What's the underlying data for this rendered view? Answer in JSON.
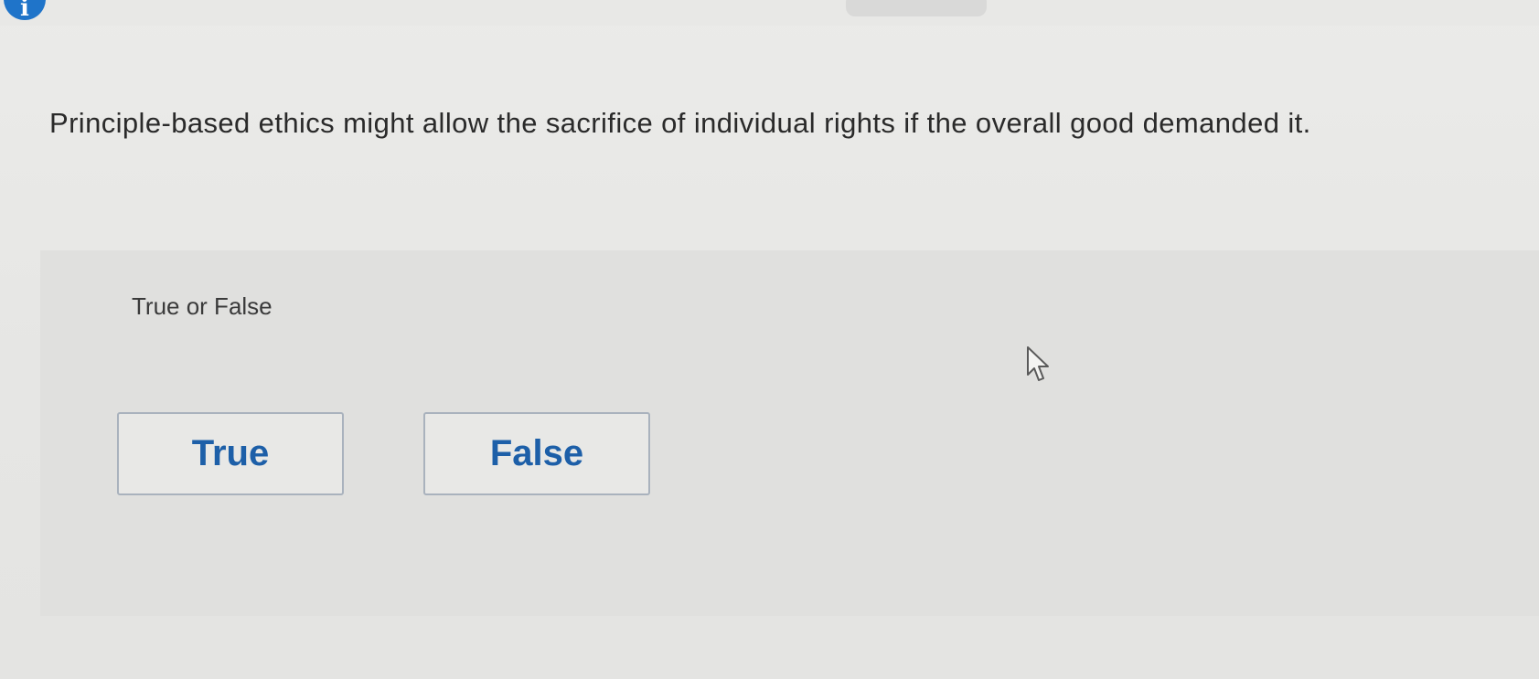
{
  "header": {
    "badge_glyph": "i"
  },
  "question": {
    "text": "Principle-based ethics might allow the sacrifice of individual rights if the overall good demanded it.",
    "prompt": "True or False"
  },
  "choices": [
    {
      "label": "True"
    },
    {
      "label": "False"
    }
  ],
  "colors": {
    "accent": "#1d5fa8",
    "badge": "#1f74c9",
    "choice_border": "#a9b2bd",
    "text": "#2a2a2a"
  },
  "icons": {
    "badge": "info-icon",
    "cursor": "mouse-pointer-icon"
  }
}
